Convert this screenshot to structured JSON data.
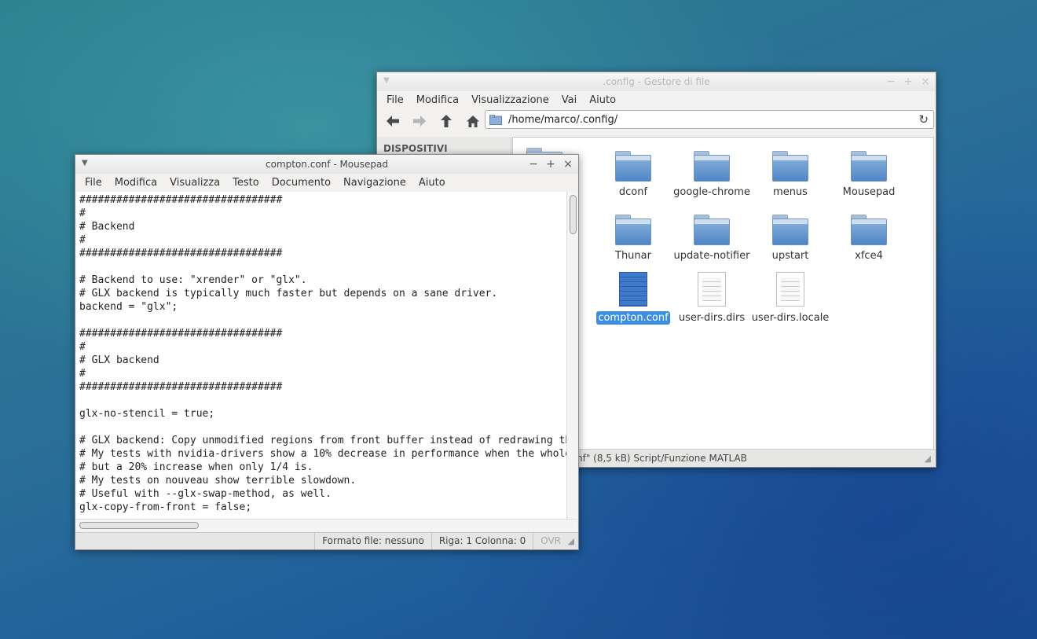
{
  "thunar": {
    "title": ".config - Gestore di file",
    "menu": [
      "File",
      "Modifica",
      "Visualizzazione",
      "Vai",
      "Aiuto"
    ],
    "location": "/home/marco/.config/",
    "sidebar_header": "DISPOSITIVI",
    "files": [
      {
        "name": "dconf",
        "kind": "folder"
      },
      {
        "name": "google-chrome",
        "kind": "folder"
      },
      {
        "name": "menus",
        "kind": "folder"
      },
      {
        "name": "Mousepad",
        "kind": "folder"
      },
      {
        "name": "Thunar",
        "kind": "folder"
      },
      {
        "name": "update-notifier",
        "kind": "folder"
      },
      {
        "name": "upstart",
        "kind": "folder"
      },
      {
        "name": "xfce4",
        "kind": "folder"
      },
      {
        "name": "compton.conf",
        "kind": "file",
        "selected": true
      },
      {
        "name": "user-dirs.dirs",
        "kind": "file"
      },
      {
        "name": "user-dirs.locale",
        "kind": "file"
      }
    ],
    "partial_label": "n",
    "status": "nf\" (8,5 kB) Script/Funzione MATLAB"
  },
  "mousepad": {
    "title": "compton.conf - Mousepad",
    "menu": [
      "File",
      "Modifica",
      "Visualizza",
      "Testo",
      "Documento",
      "Navigazione",
      "Aiuto"
    ],
    "content": "#################################\n#\n# Backend\n#\n#################################\n\n# Backend to use: \"xrender\" or \"glx\".\n# GLX backend is typically much faster but depends on a sane driver.\nbackend = \"glx\";\n\n#################################\n#\n# GLX backend\n#\n#################################\n\nglx-no-stencil = true;\n\n# GLX backend: Copy unmodified regions from front buffer instead of redrawing them all.\n# My tests with nvidia-drivers show a 10% decrease in performance when the whole screen is modified,\n# but a 20% increase when only 1/4 is.\n# My tests on nouveau show terrible slowdown.\n# Useful with --glx-swap-method, as well.\nglx-copy-from-front = false;",
    "status_format": "Formato file: nessuno",
    "status_position": "Riga: 1 Colonna: 0",
    "status_ovr": "OVR"
  }
}
